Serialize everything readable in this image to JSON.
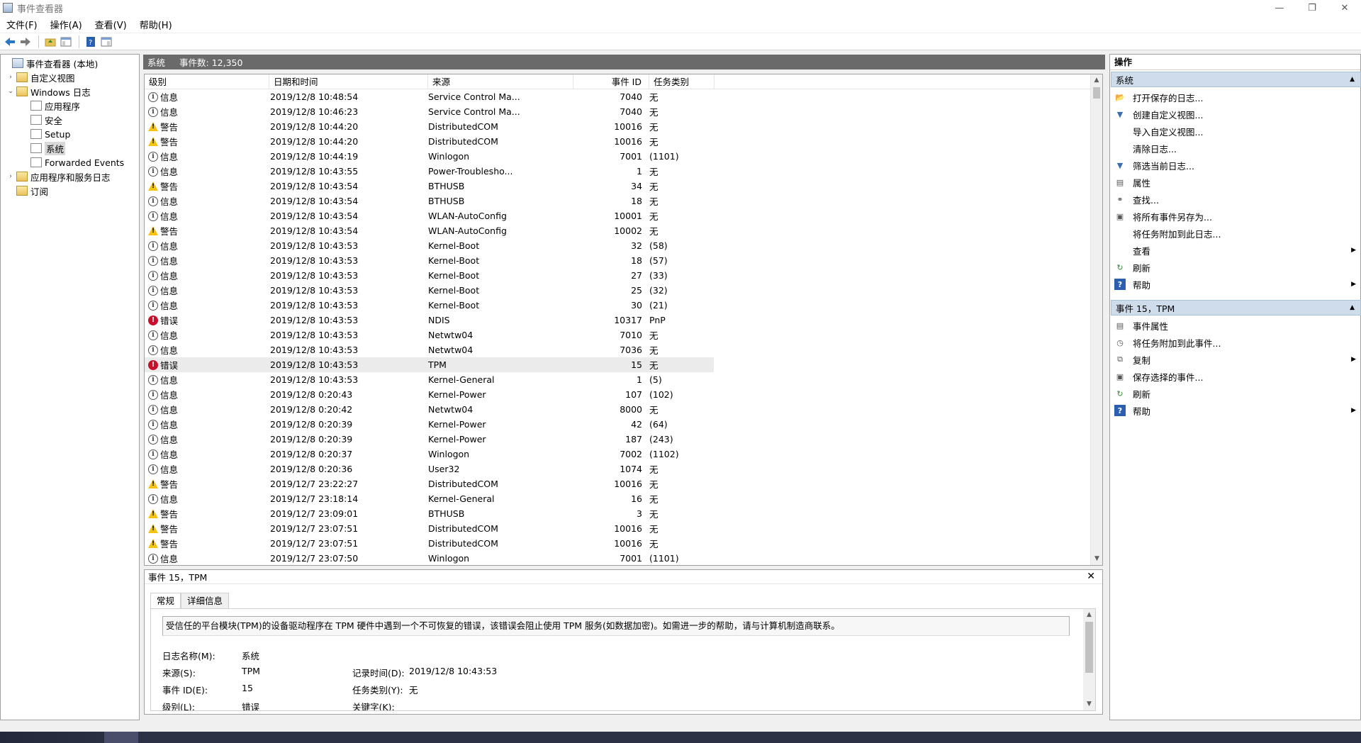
{
  "window": {
    "title": "事件查看器",
    "buttons": [
      "—",
      "❐",
      "✕"
    ]
  },
  "menu": [
    "文件(F)",
    "操作(A)",
    "查看(V)",
    "帮助(H)"
  ],
  "tree": [
    {
      "label": "事件查看器 (本地)",
      "level": 0,
      "icon": "root",
      "exp": ""
    },
    {
      "label": "自定义视图",
      "level": 1,
      "icon": "folder",
      "exp": "›"
    },
    {
      "label": "Windows 日志",
      "level": 1,
      "icon": "folder",
      "exp": "⌄"
    },
    {
      "label": "应用程序",
      "level": 2,
      "icon": "log",
      "exp": ""
    },
    {
      "label": "安全",
      "level": 2,
      "icon": "log",
      "exp": ""
    },
    {
      "label": "Setup",
      "level": 2,
      "icon": "log",
      "exp": ""
    },
    {
      "label": "系统",
      "level": 2,
      "icon": "log",
      "exp": "",
      "selected": true
    },
    {
      "label": "Forwarded Events",
      "level": 2,
      "icon": "log",
      "exp": ""
    },
    {
      "label": "应用程序和服务日志",
      "level": 1,
      "icon": "folder",
      "exp": "›"
    },
    {
      "label": "订阅",
      "level": 1,
      "icon": "folder",
      "exp": ""
    }
  ],
  "middle": {
    "title": "系统",
    "count": "事件数: 12,350"
  },
  "columns": {
    "level": "级别",
    "date": "日期和时间",
    "source": "来源",
    "id": "事件 ID",
    "task": "任务类别"
  },
  "events": [
    {
      "level": "info",
      "label": "信息",
      "date": "2019/12/8 10:48:54",
      "source": "Service Control Ma...",
      "id": "7040",
      "task": "无"
    },
    {
      "level": "info",
      "label": "信息",
      "date": "2019/12/8 10:46:23",
      "source": "Service Control Ma...",
      "id": "7040",
      "task": "无"
    },
    {
      "level": "warn",
      "label": "警告",
      "date": "2019/12/8 10:44:20",
      "source": "DistributedCOM",
      "id": "10016",
      "task": "无"
    },
    {
      "level": "warn",
      "label": "警告",
      "date": "2019/12/8 10:44:20",
      "source": "DistributedCOM",
      "id": "10016",
      "task": "无"
    },
    {
      "level": "info",
      "label": "信息",
      "date": "2019/12/8 10:44:19",
      "source": "Winlogon",
      "id": "7001",
      "task": "(1101)"
    },
    {
      "level": "info",
      "label": "信息",
      "date": "2019/12/8 10:43:55",
      "source": "Power-Troublesho...",
      "id": "1",
      "task": "无"
    },
    {
      "level": "warn",
      "label": "警告",
      "date": "2019/12/8 10:43:54",
      "source": "BTHUSB",
      "id": "34",
      "task": "无"
    },
    {
      "level": "info",
      "label": "信息",
      "date": "2019/12/8 10:43:54",
      "source": "BTHUSB",
      "id": "18",
      "task": "无"
    },
    {
      "level": "info",
      "label": "信息",
      "date": "2019/12/8 10:43:54",
      "source": "WLAN-AutoConfig",
      "id": "10001",
      "task": "无"
    },
    {
      "level": "warn",
      "label": "警告",
      "date": "2019/12/8 10:43:54",
      "source": "WLAN-AutoConfig",
      "id": "10002",
      "task": "无"
    },
    {
      "level": "info",
      "label": "信息",
      "date": "2019/12/8 10:43:53",
      "source": "Kernel-Boot",
      "id": "32",
      "task": "(58)"
    },
    {
      "level": "info",
      "label": "信息",
      "date": "2019/12/8 10:43:53",
      "source": "Kernel-Boot",
      "id": "18",
      "task": "(57)"
    },
    {
      "level": "info",
      "label": "信息",
      "date": "2019/12/8 10:43:53",
      "source": "Kernel-Boot",
      "id": "27",
      "task": "(33)"
    },
    {
      "level": "info",
      "label": "信息",
      "date": "2019/12/8 10:43:53",
      "source": "Kernel-Boot",
      "id": "25",
      "task": "(32)"
    },
    {
      "level": "info",
      "label": "信息",
      "date": "2019/12/8 10:43:53",
      "source": "Kernel-Boot",
      "id": "30",
      "task": "(21)"
    },
    {
      "level": "error",
      "label": "错误",
      "date": "2019/12/8 10:43:53",
      "source": "NDIS",
      "id": "10317",
      "task": "PnP"
    },
    {
      "level": "info",
      "label": "信息",
      "date": "2019/12/8 10:43:53",
      "source": "Netwtw04",
      "id": "7010",
      "task": "无"
    },
    {
      "level": "info",
      "label": "信息",
      "date": "2019/12/8 10:43:53",
      "source": "Netwtw04",
      "id": "7036",
      "task": "无"
    },
    {
      "level": "error",
      "label": "错误",
      "date": "2019/12/8 10:43:53",
      "source": "TPM",
      "id": "15",
      "task": "无",
      "selected": true
    },
    {
      "level": "info",
      "label": "信息",
      "date": "2019/12/8 10:43:53",
      "source": "Kernel-General",
      "id": "1",
      "task": "(5)"
    },
    {
      "level": "info",
      "label": "信息",
      "date": "2019/12/8 0:20:43",
      "source": "Kernel-Power",
      "id": "107",
      "task": "(102)"
    },
    {
      "level": "info",
      "label": "信息",
      "date": "2019/12/8 0:20:42",
      "source": "Netwtw04",
      "id": "8000",
      "task": "无"
    },
    {
      "level": "info",
      "label": "信息",
      "date": "2019/12/8 0:20:39",
      "source": "Kernel-Power",
      "id": "42",
      "task": "(64)"
    },
    {
      "level": "info",
      "label": "信息",
      "date": "2019/12/8 0:20:39",
      "source": "Kernel-Power",
      "id": "187",
      "task": "(243)"
    },
    {
      "level": "info",
      "label": "信息",
      "date": "2019/12/8 0:20:37",
      "source": "Winlogon",
      "id": "7002",
      "task": "(1102)"
    },
    {
      "level": "info",
      "label": "信息",
      "date": "2019/12/8 0:20:36",
      "source": "User32",
      "id": "1074",
      "task": "无"
    },
    {
      "level": "warn",
      "label": "警告",
      "date": "2019/12/7 23:22:27",
      "source": "DistributedCOM",
      "id": "10016",
      "task": "无"
    },
    {
      "level": "info",
      "label": "信息",
      "date": "2019/12/7 23:18:14",
      "source": "Kernel-General",
      "id": "16",
      "task": "无"
    },
    {
      "level": "warn",
      "label": "警告",
      "date": "2019/12/7 23:09:01",
      "source": "BTHUSB",
      "id": "3",
      "task": "无"
    },
    {
      "level": "warn",
      "label": "警告",
      "date": "2019/12/7 23:07:51",
      "source": "DistributedCOM",
      "id": "10016",
      "task": "无"
    },
    {
      "level": "warn",
      "label": "警告",
      "date": "2019/12/7 23:07:51",
      "source": "DistributedCOM",
      "id": "10016",
      "task": "无"
    },
    {
      "level": "info",
      "label": "信息",
      "date": "2019/12/7 23:07:50",
      "source": "Winlogon",
      "id": "7001",
      "task": "(1101)"
    }
  ],
  "detail": {
    "title": "事件 15，TPM",
    "tabs": [
      "常规",
      "详细信息"
    ],
    "description": "受信任的平台模块(TPM)的设备驱动程序在 TPM 硬件中遇到一个不可恢复的错误，该错误会阻止使用 TPM 服务(如数据加密)。如需进一步的帮助，请与计算机制造商联系。",
    "log_name_label": "日志名称(M):",
    "log_name": "系统",
    "source_label": "来源(S):",
    "source": "TPM",
    "logged_label": "记录时间(D):",
    "logged": "2019/12/8 10:43:53",
    "event_id_label": "事件 ID(E):",
    "event_id": "15",
    "task_label": "任务类别(Y):",
    "task": "无",
    "level_label": "级别(L):",
    "level": "错误",
    "keywords_label": "关键字(K):"
  },
  "actions": {
    "title": "操作",
    "section1": "系统",
    "items1": [
      {
        "label": "打开保存的日志...",
        "icon": "open-folder-icon",
        "glyph": "📂"
      },
      {
        "label": "创建自定义视图...",
        "icon": "funnel-icon",
        "glyph": "▼"
      },
      {
        "label": "导入自定义视图...",
        "icon": "",
        "glyph": ""
      },
      {
        "label": "清除日志...",
        "icon": "",
        "glyph": ""
      },
      {
        "label": "筛选当前日志...",
        "icon": "funnel-icon",
        "glyph": "▼"
      },
      {
        "label": "属性",
        "icon": "properties-icon",
        "glyph": "▤"
      },
      {
        "label": "查找...",
        "icon": "binoculars-icon",
        "glyph": "⚭"
      },
      {
        "label": "将所有事件另存为...",
        "icon": "save-icon",
        "glyph": "▣"
      },
      {
        "label": "将任务附加到此日志...",
        "icon": "",
        "glyph": ""
      },
      {
        "label": "查看",
        "icon": "",
        "glyph": "",
        "submenu": true
      },
      {
        "label": "刷新",
        "icon": "refresh-icon",
        "glyph": "↻"
      },
      {
        "label": "帮助",
        "icon": "help-icon",
        "glyph": "?",
        "submenu": true
      }
    ],
    "section2": "事件 15，TPM",
    "items2": [
      {
        "label": "事件属性",
        "icon": "properties-icon",
        "glyph": "▤"
      },
      {
        "label": "将任务附加到此事件...",
        "icon": "task-icon",
        "glyph": "◷"
      },
      {
        "label": "复制",
        "icon": "copy-icon",
        "glyph": "⧉",
        "submenu": true
      },
      {
        "label": "保存选择的事件...",
        "icon": "save-icon",
        "glyph": "▣"
      },
      {
        "label": "刷新",
        "icon": "refresh-icon",
        "glyph": "↻"
      },
      {
        "label": "帮助",
        "icon": "help-icon",
        "glyph": "?",
        "submenu": true
      }
    ]
  }
}
